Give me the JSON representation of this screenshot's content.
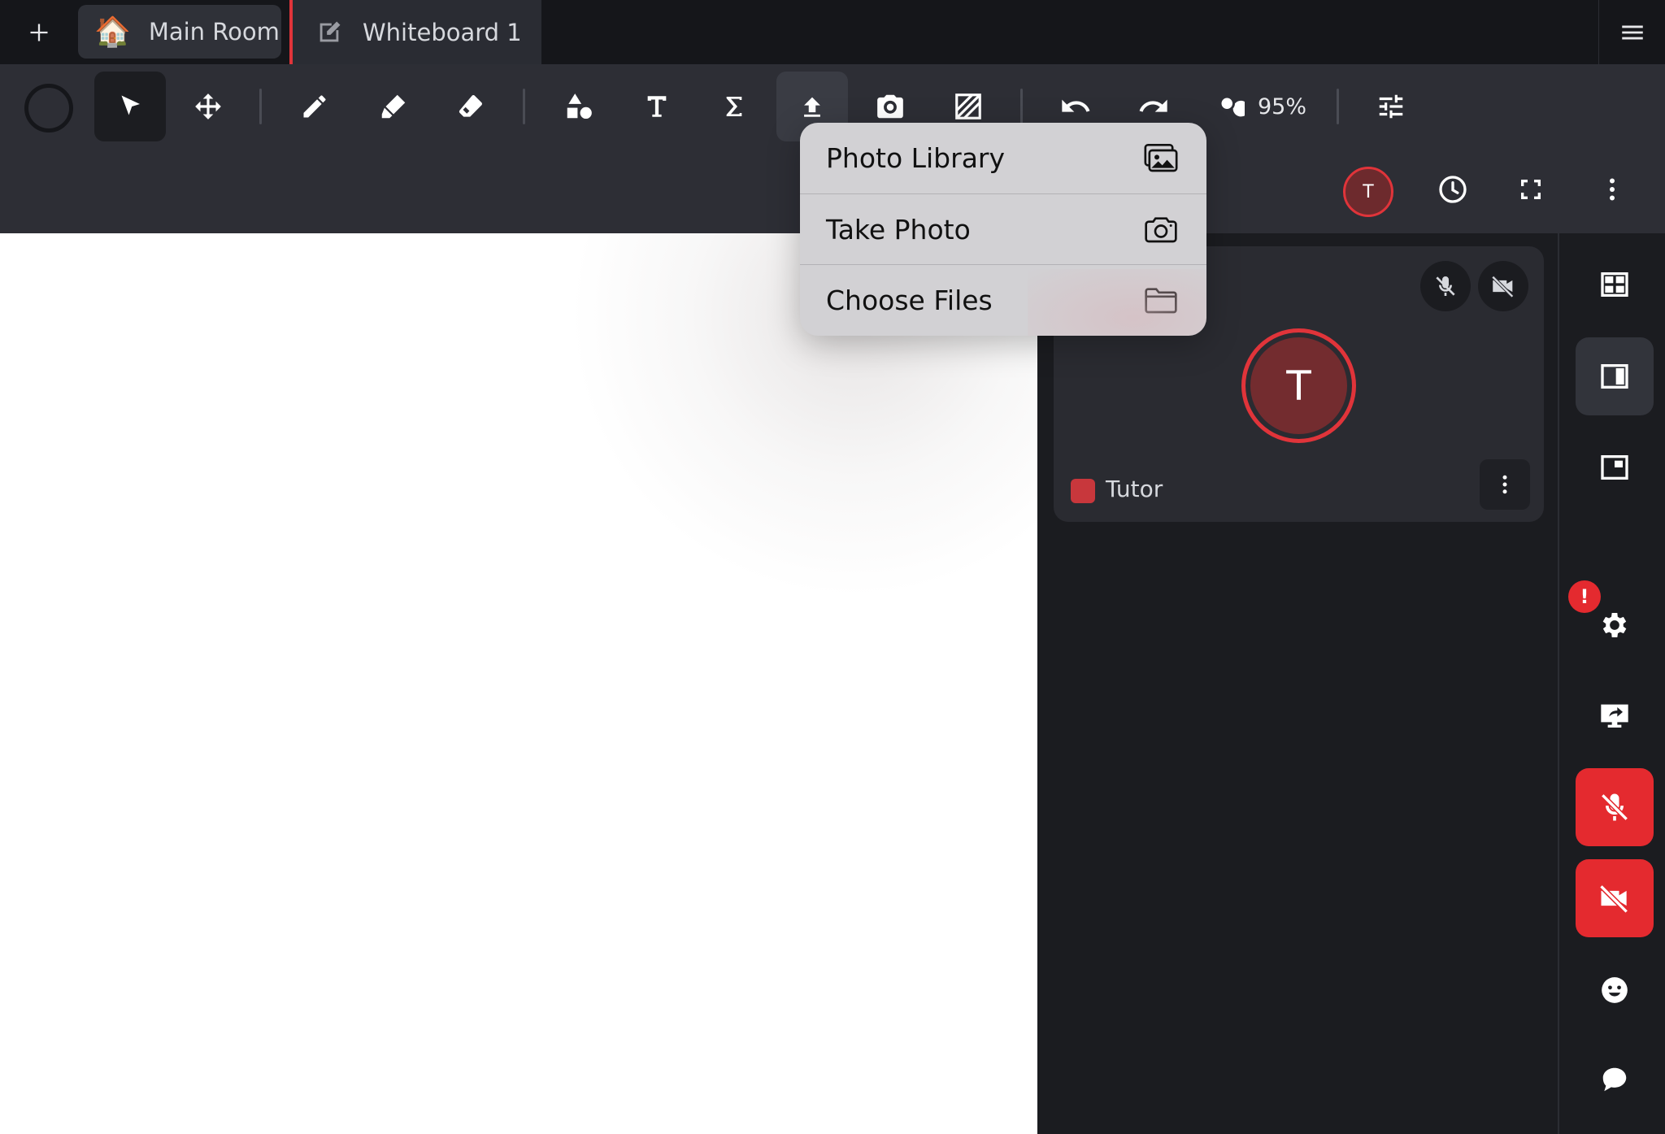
{
  "tabs": [
    {
      "label": "Main Room",
      "emoji": "🏠",
      "icon": "house-emoji"
    },
    {
      "label": "Whiteboard 1",
      "icon": "edit-note-icon"
    }
  ],
  "toolbar": {
    "zoom_label": "95%"
  },
  "user": {
    "initial": "T",
    "name": "Tutor",
    "accent": "#e0343a",
    "swatch": "#c8373c"
  },
  "upload_menu": {
    "items": [
      {
        "label": "Photo Library",
        "icon": "photo-library-icon"
      },
      {
        "label": "Take Photo",
        "icon": "camera-icon"
      },
      {
        "label": "Choose Files",
        "icon": "folder-icon"
      }
    ]
  },
  "rail": {
    "settings_badge": "!"
  },
  "colors": {
    "danger": "#e42a2f",
    "panel": "#2d2e35",
    "background": "#1b1c20"
  }
}
